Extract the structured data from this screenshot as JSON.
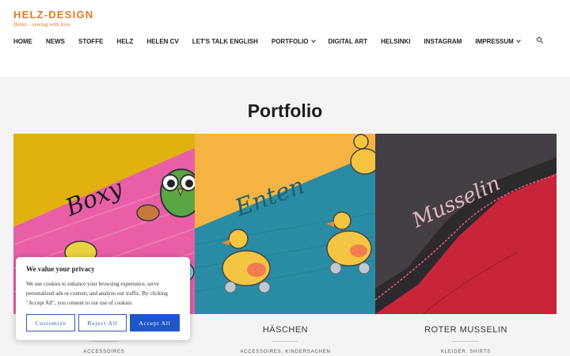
{
  "header": {
    "site_title": "HELZ-DESIGN",
    "tagline": "Helen – sewing with love"
  },
  "nav": {
    "items": [
      {
        "label": "HOME",
        "dropdown": false
      },
      {
        "label": "NEWS",
        "dropdown": false
      },
      {
        "label": "STOFFE",
        "dropdown": false
      },
      {
        "label": "HELZ",
        "dropdown": false
      },
      {
        "label": "HELEN CV",
        "dropdown": false
      },
      {
        "label": "LET'S TALK ENGLISH",
        "dropdown": false
      },
      {
        "label": "PORTFOLIO",
        "dropdown": true
      },
      {
        "label": "DIGITAL ART",
        "dropdown": false
      },
      {
        "label": "HELSINKI",
        "dropdown": false
      },
      {
        "label": "INSTAGRAM",
        "dropdown": false
      },
      {
        "label": "IMPRESSUM",
        "dropdown": true
      }
    ],
    "search_icon": "search-icon"
  },
  "main": {
    "title": "Portfolio",
    "cards": [
      {
        "image_text": "Boxy",
        "title": "",
        "categories": "ACCESSOIRES"
      },
      {
        "image_text": "Enten",
        "title": "HÄSCHEN",
        "categories": "ACCESSOIRES, KINDERSACHEN"
      },
      {
        "image_text": "Musselin",
        "title": "ROTER MUSSELIN",
        "categories": "KLEIDER, SHIRTS"
      }
    ]
  },
  "cookie": {
    "title": "We value your privacy",
    "text": "We use cookies to enhance your browsing experience, serve personalized ads or content, and analyze our traffic. By clicking \"Accept All\", you consent to our use of cookies.",
    "customize_label": "Customize",
    "reject_label": "Reject All",
    "accept_label": "Accept All"
  },
  "colors": {
    "brand": "#e07b22",
    "accent": "#1f56c9"
  }
}
